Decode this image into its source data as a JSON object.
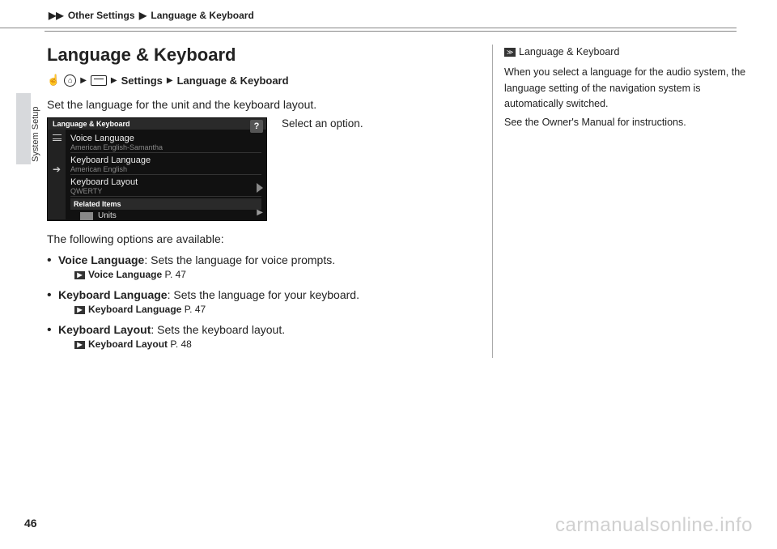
{
  "breadcrumb": {
    "arrow": "▶▶",
    "item1": "Other Settings",
    "sep": "▶",
    "item2": "Language & Keyboard"
  },
  "sidetab": "System Setup",
  "title": "Language & Keyboard",
  "navline": {
    "sep": "▶",
    "settings": "Settings",
    "page": "Language & Keyboard"
  },
  "intro": "Set the language for the unit and the keyboard layout.",
  "instruction": "Select an option.",
  "screenshot": {
    "header": "Language & Keyboard",
    "help": "?",
    "item1": {
      "title": "Voice Language",
      "sub": "American English-Samantha"
    },
    "item2": {
      "title": "Keyboard Language",
      "sub": "American English"
    },
    "item3": {
      "title": "Keyboard Layout",
      "sub": "QWERTY"
    },
    "related": "Related Items",
    "units": "Units"
  },
  "following": "The following options are available:",
  "options": {
    "voice": {
      "label": "Voice Language",
      "desc": ": Sets the language for voice prompts.",
      "ref": "Voice Language",
      "pg": "P. 47"
    },
    "kblang": {
      "label": "Keyboard Language",
      "desc": ": Sets the language for your keyboard.",
      "ref": "Keyboard Language",
      "pg": "P. 47"
    },
    "kblayout": {
      "label": "Keyboard Layout",
      "desc": ": Sets the keyboard layout.",
      "ref": "Keyboard Layout",
      "pg": "P. 48"
    }
  },
  "sidebar": {
    "header": "Language & Keyboard",
    "p1": "When you select a language for the audio system, the language setting of the navigation system is automatically switched.",
    "p2": "See the Owner's Manual for instructions."
  },
  "pagenum": "46",
  "watermark": "carmanualsonline.info"
}
